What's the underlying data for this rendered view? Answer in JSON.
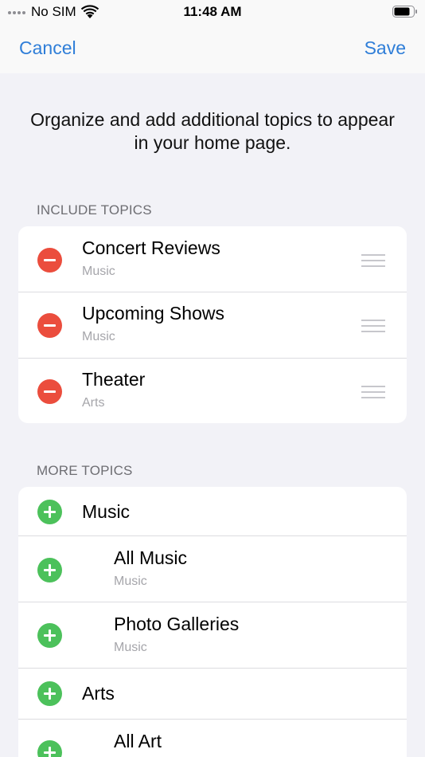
{
  "status_bar": {
    "carrier": "No SIM",
    "time": "11:48 AM"
  },
  "nav": {
    "cancel_label": "Cancel",
    "save_label": "Save"
  },
  "intro_text": "Organize and add additional topics to appear in your home page.",
  "include_section": {
    "header": "INCLUDE TOPICS",
    "items": [
      {
        "title": "Concert Reviews",
        "subtitle": "Music"
      },
      {
        "title": "Upcoming Shows",
        "subtitle": "Music"
      },
      {
        "title": "Theater",
        "subtitle": "Arts"
      }
    ]
  },
  "more_section": {
    "header": "MORE TOPICS",
    "items": [
      {
        "title": "Music"
      },
      {
        "title": "All Music",
        "subtitle": "Music"
      },
      {
        "title": "Photo Galleries",
        "subtitle": "Music"
      },
      {
        "title": "Arts"
      },
      {
        "title": "All Art"
      }
    ]
  },
  "colors": {
    "accent": "#2f7ed8",
    "remove": "#eb4d3d",
    "add": "#4cc15b",
    "background": "#f2f2f7"
  },
  "icons": {
    "remove": "minus-circle-icon",
    "add": "plus-circle-icon",
    "reorder": "reorder-handle-icon"
  }
}
